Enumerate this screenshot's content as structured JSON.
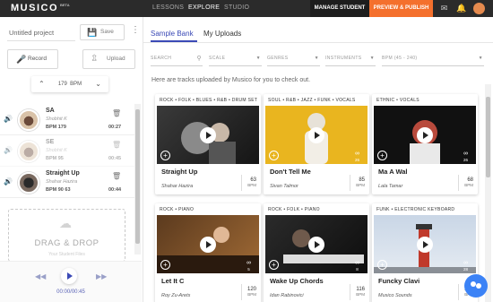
{
  "topbar": {
    "logo": "MUSICO",
    "logo_badge": "BETA",
    "nav": [
      "LESSONS",
      "EXPLORE",
      "STUDIO"
    ],
    "active_nav": "EXPLORE",
    "manage_student": "MANAGE STUDENT",
    "preview_publish": "PREVIEW & PUBLISH",
    "icons": [
      "mail-icon",
      "bell-icon",
      "avatar"
    ],
    "colors": {
      "bar": "#2b2b2b",
      "publish": "#f4702d"
    }
  },
  "left": {
    "project_name": "Untitled project",
    "save_label": "Save",
    "record_label": "Record",
    "upload_label": "Upload",
    "bpm_value": "179",
    "bpm_unit": "BPM",
    "tracks": [
      {
        "name": "SA",
        "artist": "Shobhit K",
        "bpm": "BPM 179",
        "duration": "00:27",
        "color": "#f4702d"
      },
      {
        "name": "SE",
        "artist": "Shobhit K",
        "bpm": "BPM 95",
        "duration": "00:45",
        "color": "#f4702d"
      },
      {
        "name": "Straight Up",
        "artist": "Shahar Hazira",
        "bpm": "BPM 90 63",
        "duration": "00:44",
        "color": "#1a9c9c"
      }
    ],
    "drop_title": "DRAG & DROP",
    "drop_sub": "Your Student Files",
    "time": "00:00/00:45",
    "accent": "#3b4ab6"
  },
  "main": {
    "tabs": [
      "Sample Bank",
      "My Uploads"
    ],
    "active_tab": "Sample Bank",
    "filters": {
      "search_placeholder": "SEARCH",
      "scale": "SCALE",
      "genres": "GENRES",
      "instruments": "INSTRUMENTS",
      "bpm": "BPM (45 - 240)"
    },
    "intro": "Here are tracks uploaded by Musico for you to check out.",
    "cards": [
      {
        "genre": "ROCK • FOLK • BLUES • R&B • DRUM SET",
        "title": "Straight Up",
        "author": "Shahar Hazira",
        "bpm": "63",
        "bpm_unit": "BPM",
        "loops": ""
      },
      {
        "genre": "SOUL • R&B • JAZZ • FUNK • VOCALS",
        "title": "Don't Tell Me",
        "author": "Sivan Talmor",
        "bpm": "85",
        "bpm_unit": "BPM",
        "loops": "26"
      },
      {
        "genre": "ETHNIC • VOCALS",
        "title": "Ma A Wal",
        "author": "Lala Tamar",
        "bpm": "68",
        "bpm_unit": "BPM",
        "loops": "26"
      },
      {
        "genre": "ROCK • PIANO",
        "title": "Let It C",
        "author": "Roy Zu-Arets",
        "bpm": "120",
        "bpm_unit": "BPM",
        "loops": "5"
      },
      {
        "genre": "ROCK • FOLK • PIANO",
        "title": "Wake Up Chords",
        "author": "Idan Rabinovici",
        "bpm": "116",
        "bpm_unit": "BPM",
        "loops": "8"
      },
      {
        "genre": "FUNK • ELECTRONIC KEYBOARD",
        "title": "Funcky Clavi",
        "author": "Musico Sounds",
        "bpm": "100",
        "bpm_unit": "BPM",
        "loops": "28"
      }
    ]
  }
}
